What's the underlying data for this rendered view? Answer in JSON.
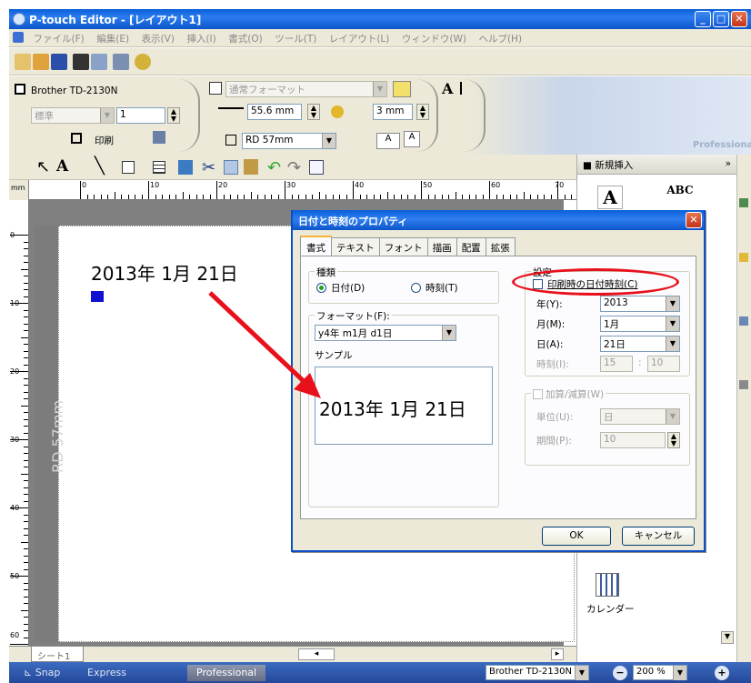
{
  "window": {
    "title": "P-touch Editor - [レイアウト1]"
  },
  "menu": [
    "ファイル(F)",
    "編集(E)",
    "表示(V)",
    "挿入(I)",
    "書式(O)",
    "ツール(T)",
    "レイアウト(L)",
    "ウィンドウ(W)",
    "ヘルプ(H)"
  ],
  "panel": {
    "printer": "Brother TD-2130N",
    "quality": "標準",
    "copies": "1",
    "print_label": "印刷",
    "format": "通常フォーマット",
    "length": "55.6 mm",
    "margin": "3 mm",
    "tape": "RD 57mm",
    "brand": "Professional"
  },
  "ruler": {
    "unit": "mm",
    "marks": [
      "0",
      "10",
      "20",
      "30",
      "40",
      "50",
      "60",
      "70"
    ]
  },
  "vruler": {
    "marks": [
      "0",
      "10",
      "20",
      "30",
      "40",
      "50",
      "60"
    ]
  },
  "label": {
    "text": "2013年 1月 21日",
    "tape": "RD 57mm"
  },
  "sheet": {
    "tab": "シート1"
  },
  "right_panel": {
    "header": "■ 新規挿入",
    "calendar": "カレンダー"
  },
  "dialog": {
    "title": "日付と時刻のプロパティ",
    "tabs": [
      "書式",
      "テキスト",
      "フォント",
      "描画",
      "配置",
      "拡張"
    ],
    "kind_label": "種類",
    "date_label": "日付(D)",
    "time_label": "時刻(T)",
    "format_label": "フォーマット(F):",
    "format_value": "y4年 m1月 d1日",
    "sample_label": "サンプル",
    "sample_value": "2013年 1月 21日",
    "settings_label": "設定",
    "print_time_label": "印刷時の日付時刻(C)",
    "year_label": "年(Y):",
    "year_value": "2013",
    "month_label": "月(M):",
    "month_value": "1月",
    "day_label": "日(A):",
    "day_value": "21日",
    "time_field_label": "時刻(I):",
    "hour_value": "15",
    "minute_value": "10",
    "addsub_label": "加算/減算(W)",
    "unit_label": "単位(U):",
    "unit_value": "日",
    "period_label": "期間(P):",
    "period_value": "10",
    "ok": "OK",
    "cancel": "キャンセル"
  },
  "status": {
    "modes": [
      "Snap",
      "Express",
      "Professional"
    ],
    "printer": "Brother TD-2130N",
    "zoom": "200 %"
  }
}
